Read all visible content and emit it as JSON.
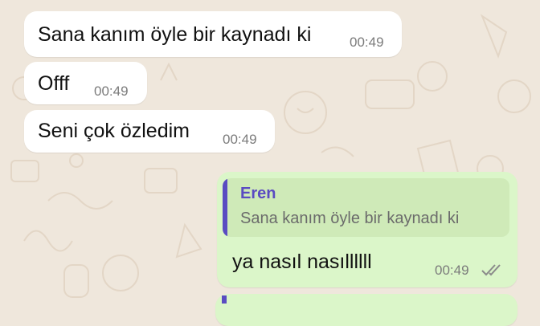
{
  "colors": {
    "incoming_bubble": "#ffffff",
    "outgoing_bubble": "#dbf6c9",
    "quote_accent": "#5a4bc2",
    "wallpaper": "#efe7dc"
  },
  "messages": [
    {
      "direction": "incoming",
      "text": "Sana kanım öyle bir kaynadı ki",
      "time": "00:49"
    },
    {
      "direction": "incoming",
      "text": "Offf",
      "time": "00:49"
    },
    {
      "direction": "incoming",
      "text": "Seni çok özledim",
      "time": "00:49"
    },
    {
      "direction": "outgoing",
      "reply_to": {
        "sender": "Eren",
        "text": "Sana kanım öyle bir kaynadı ki"
      },
      "text": "ya nasıl nasıllllll",
      "time": "00:49",
      "status_icon": "double-check-icon"
    }
  ]
}
